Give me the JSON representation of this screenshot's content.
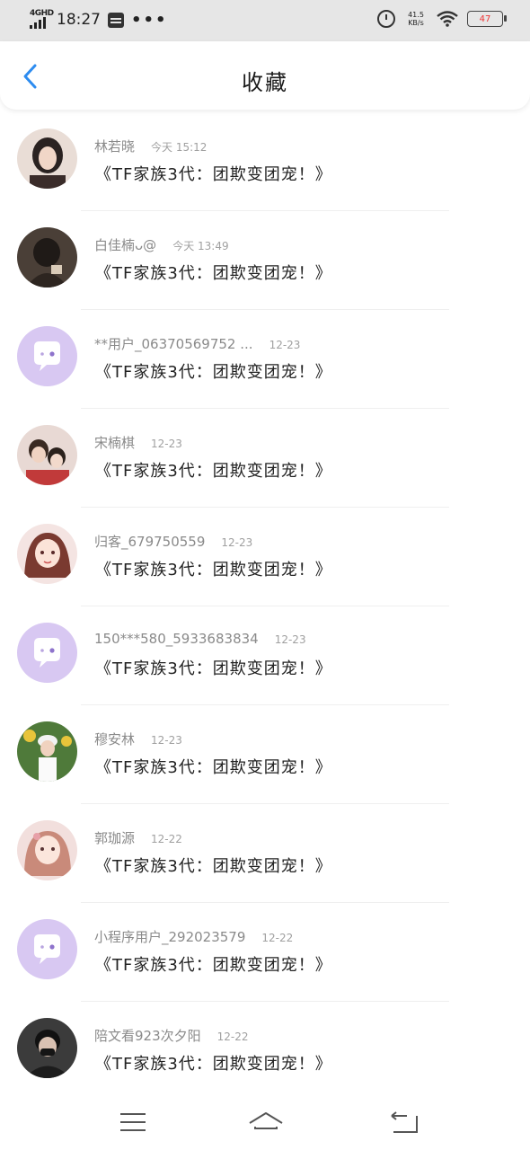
{
  "status_bar": {
    "network": "4GHD",
    "time": "18:27",
    "more": "•••",
    "speed_value": "41.5",
    "speed_unit": "KB/s",
    "battery": "47"
  },
  "header": {
    "title": "收藏",
    "back_icon": "chevron-left-icon"
  },
  "colors": {
    "accent": "#2d8cf0",
    "placeholder_avatar": "#d8c8f2"
  },
  "items": [
    {
      "user": "林若晓",
      "time": "今天 15:12",
      "content": "《TF家族3代：团欺变团宠！》",
      "avatar": "photo"
    },
    {
      "user": "白佳楠ᴗ@",
      "time": "今天 13:49",
      "content": "《TF家族3代：团欺变团宠！》",
      "avatar": "photo"
    },
    {
      "user": "**用户_06370569752 ...",
      "time": "12-23",
      "content": "《TF家族3代：团欺变团宠！》",
      "avatar": "default"
    },
    {
      "user": "宋楠棋",
      "time": "12-23",
      "content": "《TF家族3代：团欺变团宠！》",
      "avatar": "photo"
    },
    {
      "user": "归客_679750559",
      "time": "12-23",
      "content": "《TF家族3代：团欺变团宠！》",
      "avatar": "photo"
    },
    {
      "user": "150***580_5933683834",
      "time": "12-23",
      "content": "《TF家族3代：团欺变团宠！》",
      "avatar": "default"
    },
    {
      "user": "穆安林",
      "time": "12-23",
      "content": "《TF家族3代：团欺变团宠！》",
      "avatar": "photo"
    },
    {
      "user": "郭珈源",
      "time": "12-22",
      "content": "《TF家族3代：团欺变团宠！》",
      "avatar": "photo"
    },
    {
      "user": "小程序用户_292023579",
      "time": "12-22",
      "content": "《TF家族3代：团欺变团宠！》",
      "avatar": "default"
    },
    {
      "user": "陪文看923次夕阳",
      "time": "12-22",
      "content": "《TF家族3代：团欺变团宠！》",
      "avatar": "photo"
    }
  ],
  "nav": {
    "menu_icon": "menu-icon",
    "home_icon": "home-icon",
    "back_icon": "back-icon"
  }
}
